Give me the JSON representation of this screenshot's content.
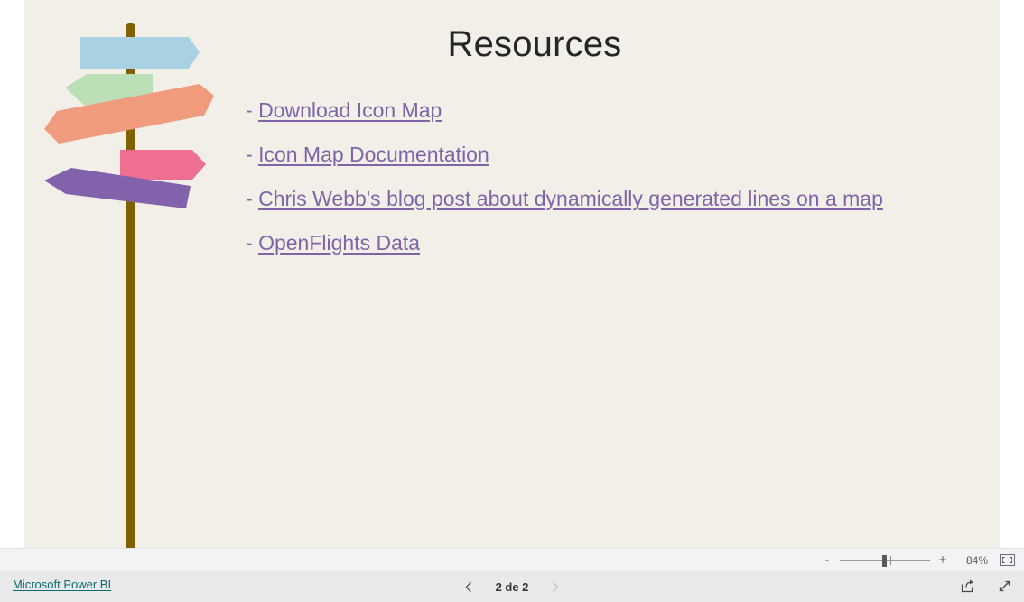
{
  "slide": {
    "title": "Resources",
    "background_color": "#f2efe9",
    "links": [
      {
        "dash": "-",
        "label": "Download Icon Map"
      },
      {
        "dash": "-",
        "label": "Icon Map Documentation"
      },
      {
        "dash": "-",
        "label": "Chris Webb's blog post about dynamically generated lines on a map"
      },
      {
        "dash": "-",
        "label": "OpenFlights Data"
      }
    ],
    "link_color": "#8064a8",
    "title_color": "#262626",
    "signpost": {
      "pole_color": "#806000",
      "signs": [
        {
          "name": "blue-sign",
          "color": "#a8d2e2",
          "direction": "right"
        },
        {
          "name": "green-sign",
          "color": "#bbdfb7",
          "direction": "left"
        },
        {
          "name": "salmon-sign",
          "color": "#f09a7e",
          "direction": "both"
        },
        {
          "name": "pink-sign",
          "color": "#ef6f90",
          "direction": "right"
        },
        {
          "name": "purple-sign",
          "color": "#8262ab",
          "direction": "left"
        }
      ]
    }
  },
  "zoom_bar": {
    "zoom_out_label": "-",
    "zoom_in_label": "+",
    "zoom_percent": "84%",
    "slider_value": 47,
    "fit_to_page_icon": "fit-page-icon"
  },
  "status_bar": {
    "brand": "Microsoft Power BI",
    "prev_page_icon": "chevron-left-icon",
    "next_page_icon": "chevron-right-icon",
    "page_indicator": "2 de 2",
    "share_icon": "share-icon",
    "fullscreen_icon": "fullscreen-icon",
    "brand_color": "#0c6a72"
  }
}
